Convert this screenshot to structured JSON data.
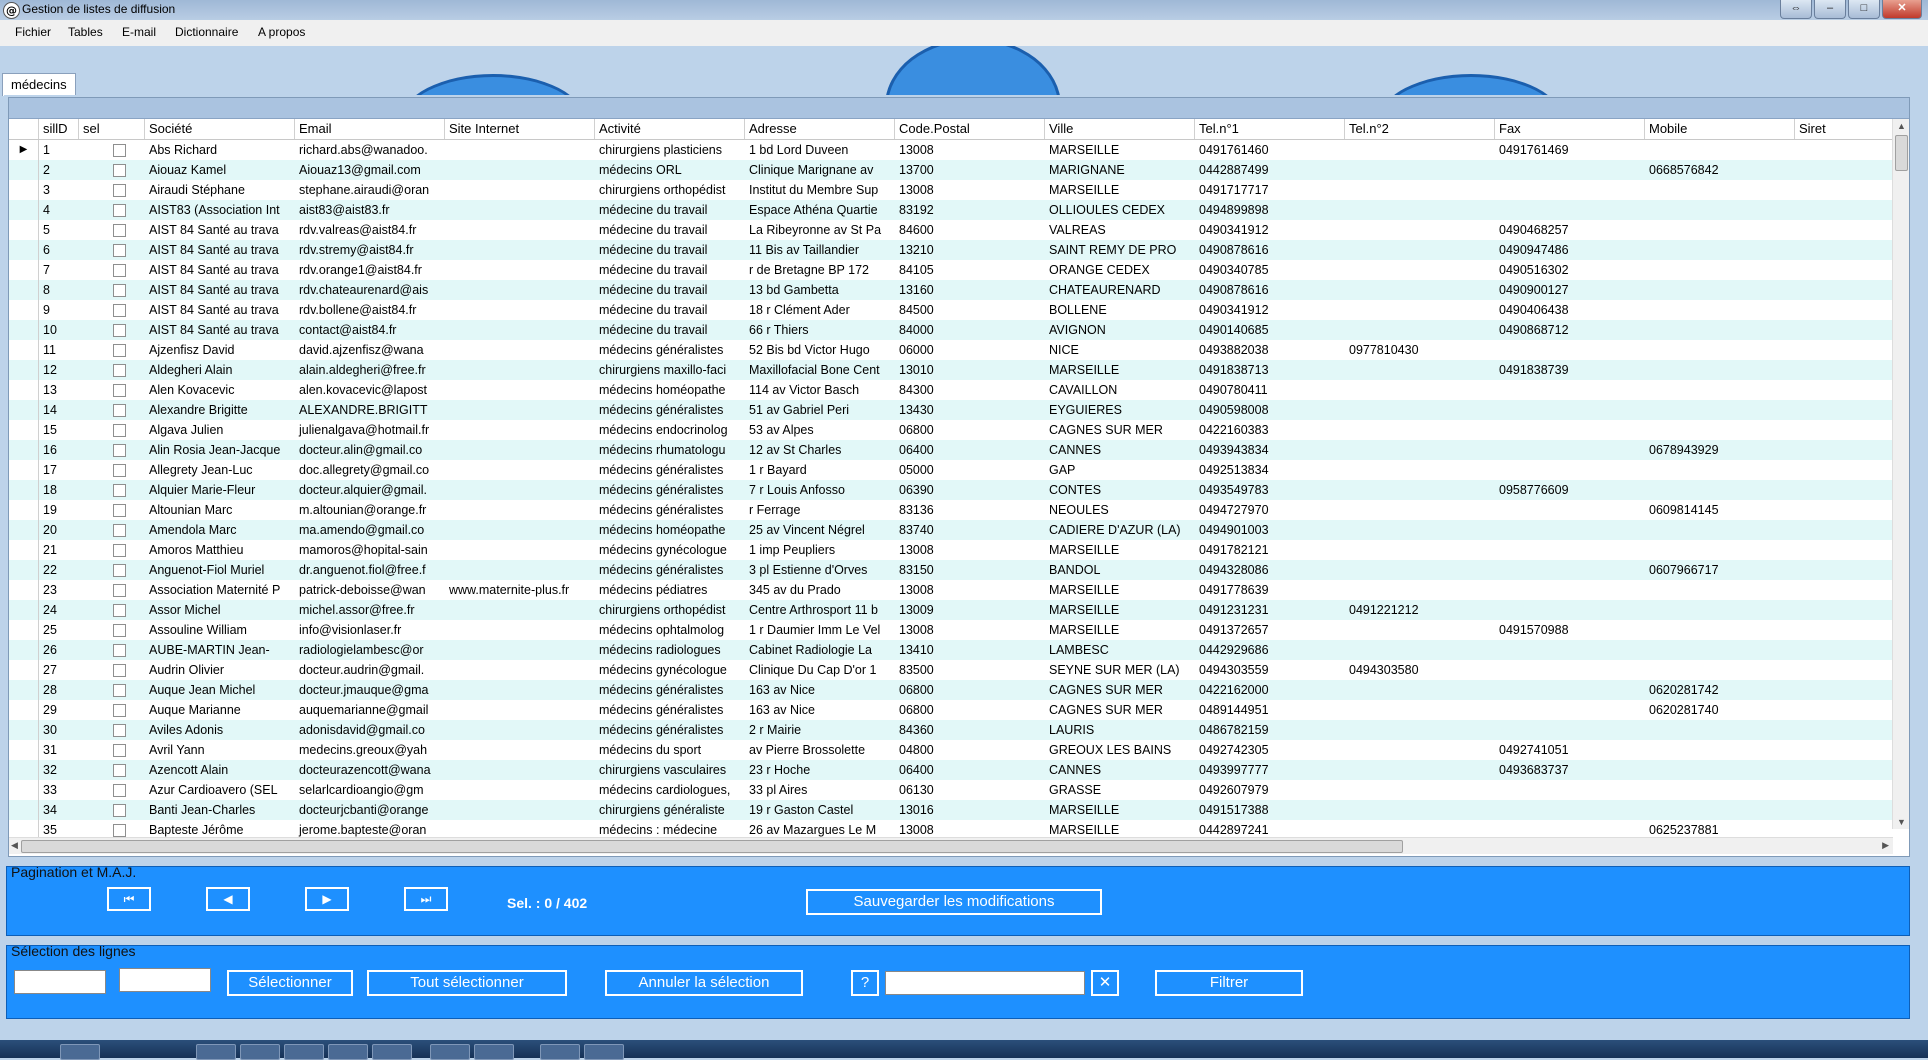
{
  "window": {
    "title": "Gestion de listes de diffusion",
    "controls": [
      "⇔",
      "–",
      "□",
      "✕"
    ]
  },
  "menu": [
    "Fichier",
    "Tables",
    "E-mail",
    "Dictionnaire",
    "A propos"
  ],
  "tab": {
    "label": "médecins"
  },
  "grid": {
    "columns": [
      "sillD",
      "sel",
      "Société",
      "Email",
      "Site Internet",
      "Activité",
      "Adresse",
      "Code.Postal",
      "Ville",
      "Tel.n°1",
      "Tel.n°2",
      "Fax",
      "Mobile",
      "Siret"
    ],
    "rows": [
      [
        "1",
        "",
        "Abs Richard",
        "richard.abs@wanadoo.",
        "",
        "chirurgiens plasticiens",
        "1 bd Lord Duveen",
        "13008",
        "MARSEILLE",
        "0491761460",
        "",
        "0491761469",
        "",
        ""
      ],
      [
        "2",
        "",
        "Aiouaz Kamel",
        "Aiouaz13@gmail.com",
        "",
        "médecins ORL",
        "Clinique Marignane av",
        "13700",
        "MARIGNANE",
        "0442887499",
        "",
        "",
        "0668576842",
        ""
      ],
      [
        "3",
        "",
        "Airaudi Stéphane",
        "stephane.airaudi@oran",
        "",
        "chirurgiens orthopédist",
        "Institut du Membre Sup",
        "13008",
        "MARSEILLE",
        "0491717717",
        "",
        "",
        "",
        ""
      ],
      [
        "4",
        "",
        "AIST83 (Association Int",
        "aist83@aist83.fr",
        "",
        "médecine du travail",
        "Espace Athéna Quartie",
        "83192",
        "OLLIOULES CEDEX",
        "0494899898",
        "",
        "",
        "",
        ""
      ],
      [
        "5",
        "",
        "AIST 84 Santé au trava",
        "rdv.valreas@aist84.fr",
        "",
        "médecine du travail",
        "La Ribeyronne av St Pa",
        "84600",
        "VALREAS",
        "0490341912",
        "",
        "0490468257",
        "",
        ""
      ],
      [
        "6",
        "",
        "AIST 84 Santé au trava",
        "rdv.stremy@aist84.fr",
        "",
        "médecine du travail",
        "11 Bis av Taillandier",
        "13210",
        "SAINT REMY DE PRO",
        "0490878616",
        "",
        "0490947486",
        "",
        ""
      ],
      [
        "7",
        "",
        "AIST 84 Santé au trava",
        "rdv.orange1@aist84.fr",
        "",
        "médecine du travail",
        "r de Bretagne BP 172",
        "84105",
        "ORANGE CEDEX",
        "0490340785",
        "",
        "0490516302",
        "",
        ""
      ],
      [
        "8",
        "",
        "AIST 84 Santé au trava",
        "rdv.chateaurenard@ais",
        "",
        "médecine du travail",
        "13 bd Gambetta",
        "13160",
        "CHATEAURENARD",
        "0490878616",
        "",
        "0490900127",
        "",
        ""
      ],
      [
        "9",
        "",
        "AIST 84 Santé au trava",
        "rdv.bollene@aist84.fr",
        "",
        "médecine du travail",
        "18 r Clément Ader",
        "84500",
        "BOLLENE",
        "0490341912",
        "",
        "0490406438",
        "",
        ""
      ],
      [
        "10",
        "",
        "AIST 84 Santé au trava",
        "contact@aist84.fr",
        "",
        "médecine du travail",
        "66 r Thiers",
        "84000",
        "AVIGNON",
        "0490140685",
        "",
        "0490868712",
        "",
        ""
      ],
      [
        "11",
        "",
        "Ajzenfisz David",
        "david.ajzenfisz@wana",
        "",
        "médecins généralistes",
        "52 Bis bd Victor Hugo",
        "06000",
        "NICE",
        "0493882038",
        "0977810430",
        "",
        "",
        ""
      ],
      [
        "12",
        "",
        "Aldegheri Alain",
        "alain.aldegheri@free.fr",
        "",
        "chirurgiens maxillo-faci",
        "Maxillofacial Bone Cent",
        "13010",
        "MARSEILLE",
        "0491838713",
        "",
        "0491838739",
        "",
        ""
      ],
      [
        "13",
        "",
        "Alen Kovacevic",
        "alen.kovacevic@lapost",
        "",
        "médecins homéopathe",
        "114 av Victor Basch",
        "84300",
        "CAVAILLON",
        "0490780411",
        "",
        "",
        "",
        ""
      ],
      [
        "14",
        "",
        "Alexandre Brigitte",
        "ALEXANDRE.BRIGITT",
        "",
        "médecins généralistes",
        "51 av Gabriel Peri",
        "13430",
        "EYGUIERES",
        "0490598008",
        "",
        "",
        "",
        ""
      ],
      [
        "15",
        "",
        "Algava Julien",
        "julienalgava@hotmail.fr",
        "",
        "médecins endocrinolog",
        "53 av Alpes",
        "06800",
        "CAGNES SUR MER",
        "0422160383",
        "",
        "",
        "",
        ""
      ],
      [
        "16",
        "",
        "Alin Rosia Jean-Jacque",
        "docteur.alin@gmail.co",
        "",
        "médecins rhumatologu",
        "12 av St Charles",
        "06400",
        "CANNES",
        "0493943834",
        "",
        "",
        "0678943929",
        ""
      ],
      [
        "17",
        "",
        "Allegrety Jean-Luc",
        "doc.allegrety@gmail.co",
        "",
        "médecins généralistes",
        "1 r Bayard",
        "05000",
        "GAP",
        "0492513834",
        "",
        "",
        "",
        ""
      ],
      [
        "18",
        "",
        "Alquier Marie-Fleur",
        "docteur.alquier@gmail.",
        "",
        "médecins généralistes",
        "7 r Louis Anfosso",
        "06390",
        "CONTES",
        "0493549783",
        "",
        "0958776609",
        "",
        ""
      ],
      [
        "19",
        "",
        "Altounian Marc",
        "m.altounian@orange.fr",
        "",
        "médecins généralistes",
        "r Ferrage",
        "83136",
        "NEOULES",
        "0494727970",
        "",
        "",
        "0609814145",
        ""
      ],
      [
        "20",
        "",
        "Amendola Marc",
        "ma.amendo@gmail.co",
        "",
        "médecins homéopathe",
        "25 av Vincent Négrel",
        "83740",
        "CADIERE D'AZUR (LA)",
        "0494901003",
        "",
        "",
        "",
        ""
      ],
      [
        "21",
        "",
        "Amoros Matthieu",
        "mamoros@hopital-sain",
        "",
        "médecins gynécologue",
        "1 imp Peupliers",
        "13008",
        "MARSEILLE",
        "0491782121",
        "",
        "",
        "",
        ""
      ],
      [
        "22",
        "",
        "Anguenot-Fiol Muriel",
        "dr.anguenot.fiol@free.f",
        "",
        "médecins généralistes",
        "3 pl Estienne d'Orves",
        "83150",
        "BANDOL",
        "0494328086",
        "",
        "",
        "0607966717",
        ""
      ],
      [
        "23",
        "",
        "Association Maternité P",
        "patrick-deboisse@wan",
        "www.maternite-plus.fr",
        "médecins pédiatres",
        "345 av du Prado",
        "13008",
        "MARSEILLE",
        "0491778639",
        "",
        "",
        "",
        ""
      ],
      [
        "24",
        "",
        "Assor Michel",
        "michel.assor@free.fr",
        "",
        "chirurgiens orthopédist",
        "Centre Arthrosport 11 b",
        "13009",
        "MARSEILLE",
        "0491231231",
        "0491221212",
        "",
        "",
        ""
      ],
      [
        "25",
        "",
        "Assouline William",
        "info@visionlaser.fr",
        "",
        "médecins ophtalmolog",
        "1 r Daumier Imm Le Vel",
        "13008",
        "MARSEILLE",
        "0491372657",
        "",
        "0491570988",
        "",
        ""
      ],
      [
        "26",
        "",
        "AUBE-MARTIN Jean-",
        "radiologielambesc@or",
        "",
        "médecins radiologues",
        "Cabinet Radiologie La",
        "13410",
        "LAMBESC",
        "0442929686",
        "",
        "",
        "",
        ""
      ],
      [
        "27",
        "",
        "Audrin Olivier",
        "docteur.audrin@gmail.",
        "",
        "médecins gynécologue",
        "Clinique Du Cap D'or 1",
        "83500",
        "SEYNE SUR MER (LA)",
        "0494303559",
        "0494303580",
        "",
        "",
        ""
      ],
      [
        "28",
        "",
        "Auque Jean Michel",
        "docteur.jmauque@gma",
        "",
        "médecins généralistes",
        "163 av Nice",
        "06800",
        "CAGNES SUR MER",
        "0422162000",
        "",
        "",
        "0620281742",
        ""
      ],
      [
        "29",
        "",
        "Auque Marianne",
        "auquemarianne@gmail",
        "",
        "médecins généralistes",
        "163 av Nice",
        "06800",
        "CAGNES SUR MER",
        "0489144951",
        "",
        "",
        "0620281740",
        ""
      ],
      [
        "30",
        "",
        "Aviles Adonis",
        "adonisdavid@gmail.co",
        "",
        "médecins généralistes",
        "2 r Mairie",
        "84360",
        "LAURIS",
        "0486782159",
        "",
        "",
        "",
        ""
      ],
      [
        "31",
        "",
        "Avril Yann",
        "medecins.greoux@yah",
        "",
        "médecins du sport",
        "av Pierre Brossolette",
        "04800",
        "GREOUX LES BAINS",
        "0492742305",
        "",
        "0492741051",
        "",
        ""
      ],
      [
        "32",
        "",
        "Azencott Alain",
        "docteurazencott@wana",
        "",
        "chirurgiens vasculaires",
        "23 r Hoche",
        "06400",
        "CANNES",
        "0493997777",
        "",
        "0493683737",
        "",
        ""
      ],
      [
        "33",
        "",
        "Azur Cardioavero (SEL",
        "selarlcardioangio@gm",
        "",
        "médecins cardiologues,",
        "33 pl Aires",
        "06130",
        "GRASSE",
        "0492607979",
        "",
        "",
        "",
        ""
      ],
      [
        "34",
        "",
        "Banti Jean-Charles",
        "docteurjcbanti@orange",
        "",
        "chirurgiens généraliste",
        "19 r Gaston Castel",
        "13016",
        "MARSEILLE",
        "0491517388",
        "",
        "",
        "",
        ""
      ],
      [
        "35",
        "",
        "Bapteste Jérôme",
        "jerome.bapteste@oran",
        "",
        "médecins : médecine",
        "26 av Mazargues Le M",
        "13008",
        "MARSEILLE",
        "0442897241",
        "",
        "",
        "0625237881",
        ""
      ]
    ]
  },
  "pagination": {
    "legend": "Pagination et M.A.J.",
    "first": "⏮",
    "prev": "◀",
    "next": "▶",
    "last": "⏭",
    "selection_count": "Sel. : 0 / 402",
    "save_label": "Sauvegarder les modifications"
  },
  "selection": {
    "legend": "Sélection des lignes",
    "select_label": "Sélectionner",
    "select_all_label": "Tout sélectionner",
    "cancel_label": "Annuler la sélection",
    "help_label": "?",
    "clear_label": "✕",
    "filter_label": "Filtrer"
  }
}
